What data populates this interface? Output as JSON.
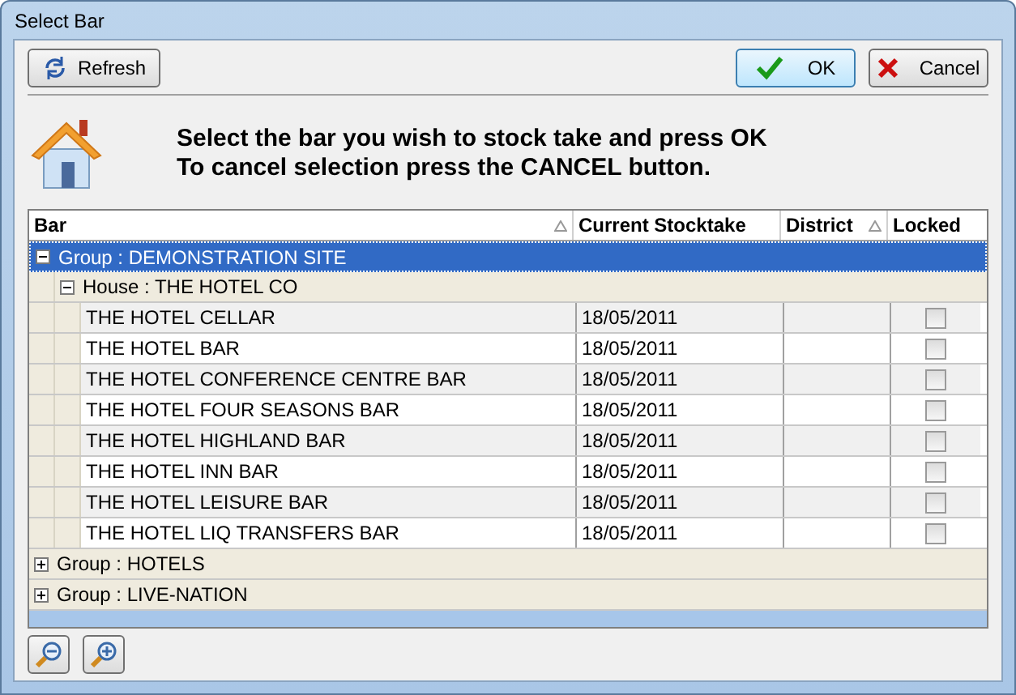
{
  "window": {
    "title": "Select Bar"
  },
  "toolbar": {
    "refresh": "Refresh",
    "ok": "OK",
    "cancel": "Cancel"
  },
  "message": [
    "Select the bar you wish to stock take and press OK",
    "To cancel selection press the CANCEL button."
  ],
  "table": {
    "columns": [
      {
        "label": "Bar",
        "sortable": true
      },
      {
        "label": "Current Stocktake",
        "sortable": false
      },
      {
        "label": "District",
        "sortable": true
      },
      {
        "label": "Locked",
        "sortable": false
      }
    ],
    "groups": [
      {
        "label": "Group : DEMONSTRATION SITE",
        "expanded": true,
        "selected": true,
        "children": [
          {
            "label": "House : THE HOTEL CO",
            "expanded": true,
            "children": [
              {
                "bar": "THE HOTEL  CELLAR",
                "stocktake": "18/05/2011",
                "locked": false
              },
              {
                "bar": "THE HOTEL BAR",
                "stocktake": "18/05/2011",
                "locked": false
              },
              {
                "bar": "THE HOTEL CONFERENCE CENTRE BAR",
                "stocktake": "18/05/2011",
                "locked": false
              },
              {
                "bar": "THE HOTEL FOUR SEASONS BAR",
                "stocktake": "18/05/2011",
                "locked": false
              },
              {
                "bar": "THE HOTEL HIGHLAND BAR",
                "stocktake": "18/05/2011",
                "locked": false
              },
              {
                "bar": "THE HOTEL INN BAR",
                "stocktake": "18/05/2011",
                "locked": false
              },
              {
                "bar": "THE HOTEL LEISURE BAR",
                "stocktake": "18/05/2011",
                "locked": false
              },
              {
                "bar": "THE HOTEL LIQ TRANSFERS BAR",
                "stocktake": "18/05/2011",
                "locked": false
              }
            ]
          }
        ]
      },
      {
        "label": "Group : HOTELS",
        "expanded": false,
        "selected": false
      },
      {
        "label": "Group : LIVE-NATION",
        "expanded": false,
        "selected": false
      }
    ]
  }
}
